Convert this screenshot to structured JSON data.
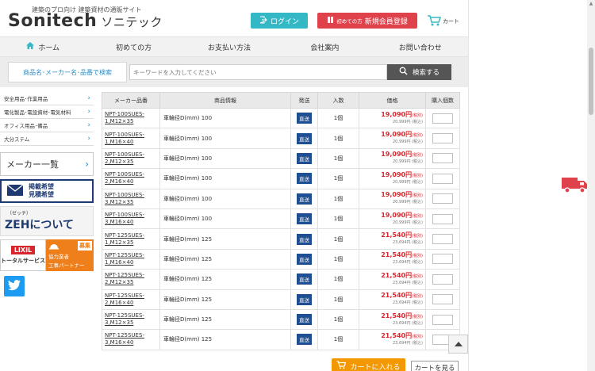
{
  "header": {
    "tagline": "建築のプロ向け 建築資材の通販サイト",
    "logo_main": "Sonitech",
    "logo_kana": "ソニテック",
    "login_label": "ログイン",
    "register_small": "初めての方",
    "register_label": "新規会員登録",
    "cart_label": "カート"
  },
  "nav": {
    "items": [
      {
        "label": "ホーム"
      },
      {
        "label": "初めての方"
      },
      {
        "label": "お支払い方法"
      },
      {
        "label": "会社案内"
      },
      {
        "label": "お問い合わせ"
      }
    ]
  },
  "search": {
    "label": "商品名･メーカー名･品番で検索",
    "placeholder": "キーワードを入力してください",
    "button_label": "検索する"
  },
  "sidebar": {
    "categories": [
      {
        "label": "安全用品･作業用品"
      },
      {
        "label": "電化製品･電設資材･電気材料"
      },
      {
        "label": "オフィス用品･備品"
      },
      {
        "label": "大分ステム"
      }
    ],
    "maker_list_label": "メーカー一覧",
    "banner_listing_line1": "掲載希望",
    "banner_listing_line2": "見積希望",
    "banner_zeh_sub": "（ゼッチ）",
    "banner_zeh_main": "ZEHについて",
    "banner_lixil_logo": "LIXIL",
    "banner_lixil_service": "トータルサービス",
    "banner_partner_badge": "募集",
    "banner_partner_line1": "協力業者",
    "banner_partner_line2": "工事パートナー"
  },
  "table": {
    "headers": {
      "code": "メーカー品番",
      "info": "商品情報",
      "ship": "発送",
      "qty": "入数",
      "price": "価格",
      "order": "購入個数"
    },
    "rows": [
      {
        "code1": "NPT-100SUES-",
        "code2": "1,M12×35",
        "info": "車輪径D(mm) 100",
        "ship": "直送",
        "qty": "1個",
        "price": "19,090円",
        "tax": "(税別)",
        "price_sub": "20,999円 (税込)"
      },
      {
        "code1": "NPT-100SUES-",
        "code2": "1,M16×40",
        "info": "車輪径D(mm) 100",
        "ship": "直送",
        "qty": "1個",
        "price": "19,090円",
        "tax": "(税別)",
        "price_sub": "20,999円 (税込)"
      },
      {
        "code1": "NPT-100SUES-",
        "code2": "2,M12×35",
        "info": "車輪径D(mm) 100",
        "ship": "直送",
        "qty": "1個",
        "price": "19,090円",
        "tax": "(税別)",
        "price_sub": "20,999円 (税込)"
      },
      {
        "code1": "NPT-100SUES-",
        "code2": "2,M16×40",
        "info": "車輪径D(mm) 100",
        "ship": "直送",
        "qty": "1個",
        "price": "19,090円",
        "tax": "(税別)",
        "price_sub": "20,999円 (税込)"
      },
      {
        "code1": "NPT-100SUES-",
        "code2": "3,M12×35",
        "info": "車輪径D(mm) 100",
        "ship": "直送",
        "qty": "1個",
        "price": "19,090円",
        "tax": "(税別)",
        "price_sub": "20,999円 (税込)"
      },
      {
        "code1": "NPT-100SUES-",
        "code2": "3,M16×40",
        "info": "車輪径D(mm) 100",
        "ship": "直送",
        "qty": "1個",
        "price": "19,090円",
        "tax": "(税別)",
        "price_sub": "20,999円 (税込)"
      },
      {
        "code1": "NPT-125SUES-",
        "code2": "1,M12×35",
        "info": "車輪径D(mm) 125",
        "ship": "直送",
        "qty": "1個",
        "price": "21,540円",
        "tax": "(税別)",
        "price_sub": "23,694円 (税込)"
      },
      {
        "code1": "NPT-125SUES-",
        "code2": "1,M16×40",
        "info": "車輪径D(mm) 125",
        "ship": "直送",
        "qty": "1個",
        "price": "21,540円",
        "tax": "(税別)",
        "price_sub": "23,694円 (税込)"
      },
      {
        "code1": "NPT-125SUES-",
        "code2": "2,M12×35",
        "info": "車輪径D(mm) 125",
        "ship": "直送",
        "qty": "1個",
        "price": "21,540円",
        "tax": "(税別)",
        "price_sub": "23,694円 (税込)"
      },
      {
        "code1": "NPT-125SUES-",
        "code2": "2,M16×40",
        "info": "車輪径D(mm) 125",
        "ship": "直送",
        "qty": "1個",
        "price": "21,540円",
        "tax": "(税別)",
        "price_sub": "23,694円 (税込)"
      },
      {
        "code1": "NPT-125SUES-",
        "code2": "3,M12×35",
        "info": "車輪径D(mm) 125",
        "ship": "直送",
        "qty": "1個",
        "price": "21,540円",
        "tax": "(税別)",
        "price_sub": "23,694円 (税込)"
      },
      {
        "code1": "NPT-125SUES-",
        "code2": "3,M16×40",
        "info": "車輪径D(mm) 125",
        "ship": "直送",
        "qty": "1個",
        "price": "21,540円",
        "tax": "(税別)",
        "price_sub": "23,694円 (税込)"
      }
    ]
  },
  "actions": {
    "add_cart_label": "カートに入れる",
    "view_cart_label": "カートを見る"
  },
  "colors": {
    "accent_teal": "#35b8c6",
    "accent_red": "#e0424c",
    "price_red": "#d9262c",
    "ship_blue": "#1e4f92",
    "cart_orange": "#f39800"
  }
}
